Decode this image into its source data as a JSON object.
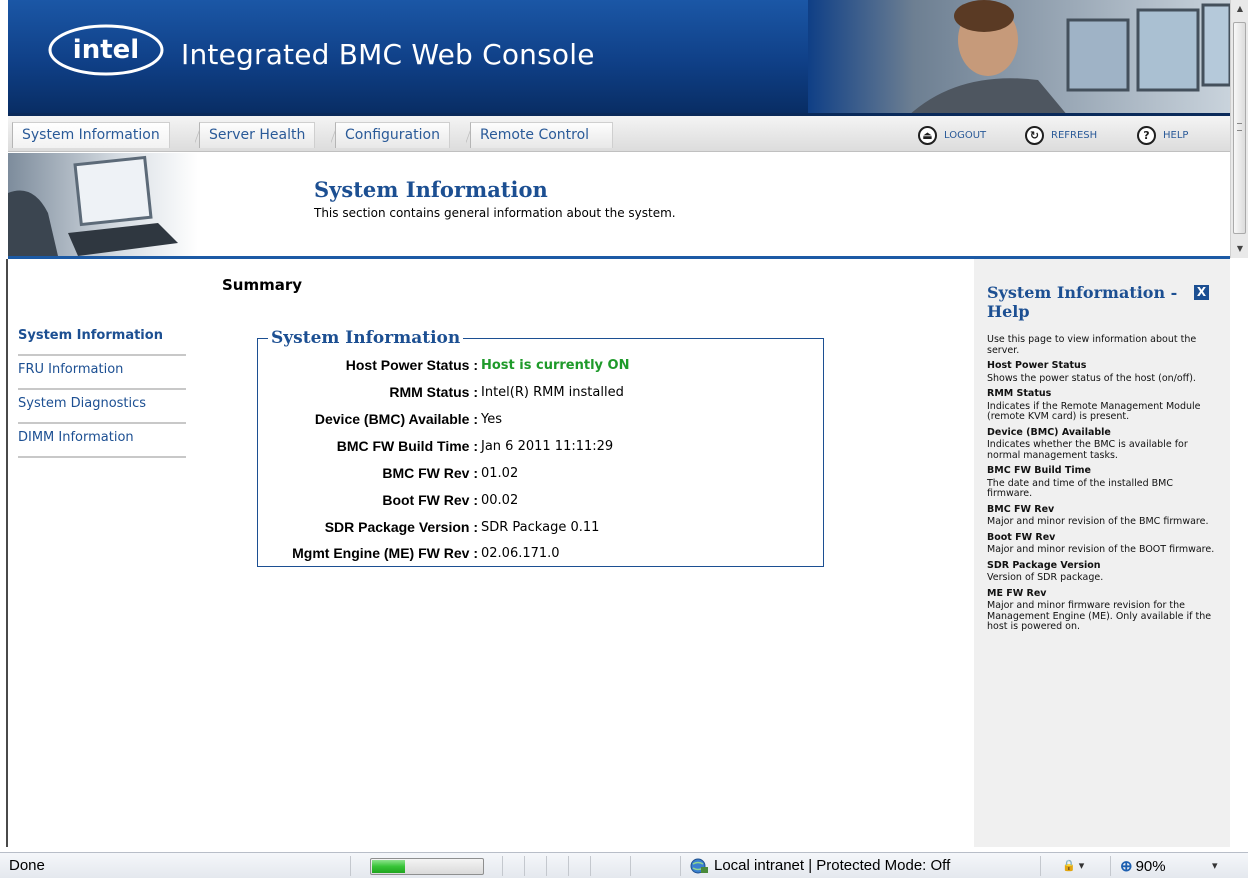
{
  "banner": {
    "brand": "intel",
    "title": "Integrated BMC Web Console"
  },
  "nav": {
    "tabs": [
      {
        "label": "System Information"
      },
      {
        "label": "Server Health"
      },
      {
        "label": "Configuration"
      },
      {
        "label": "Remote Control"
      }
    ],
    "actions": [
      {
        "label": "LOGOUT",
        "icon": "logout-icon"
      },
      {
        "label": "REFRESH",
        "icon": "refresh-icon"
      },
      {
        "label": "HELP",
        "icon": "help-icon"
      }
    ]
  },
  "header": {
    "title": "System Information",
    "description": "This section contains general information about the system."
  },
  "sidebar": {
    "items": [
      {
        "label": "System Information"
      },
      {
        "label": "FRU Information"
      },
      {
        "label": "System Diagnostics"
      },
      {
        "label": "DIMM Information"
      }
    ]
  },
  "summary": {
    "title": "Summary",
    "box_title": "System Information",
    "rows": [
      {
        "label": "Host Power Status :",
        "value": "Host is currently ON"
      },
      {
        "label": "RMM Status :",
        "value": "Intel(R) RMM installed"
      },
      {
        "label": "Device (BMC) Available :",
        "value": "Yes"
      },
      {
        "label": "BMC FW Build Time :",
        "value": "Jan 6 2011 11:11:29"
      },
      {
        "label": "BMC FW Rev :",
        "value": "01.02"
      },
      {
        "label": "Boot FW Rev :",
        "value": "00.02"
      },
      {
        "label": "SDR Package Version :",
        "value": "SDR Package 0.11"
      },
      {
        "label": "Mgmt Engine (ME) FW Rev :",
        "value": "02.06.171.0"
      }
    ]
  },
  "help": {
    "title": "System Information - Help",
    "close": "X",
    "intro": "Use this page to view information about the server.",
    "sections": [
      {
        "heading": "Host Power Status",
        "text": "Shows the power status of the host (on/off)."
      },
      {
        "heading": "RMM Status",
        "text": "Indicates if the Remote Management Module (remote KVM card) is present."
      },
      {
        "heading": "Device (BMC) Available",
        "text": "Indicates whether the BMC is available for normal management tasks."
      },
      {
        "heading": "BMC FW Build Time",
        "text": "The date and time of the installed BMC firmware."
      },
      {
        "heading": "BMC FW Rev",
        "text": "Major and minor revision of the BMC firmware."
      },
      {
        "heading": "Boot FW Rev",
        "text": "Major and minor revision of the BOOT firmware."
      },
      {
        "heading": "SDR Package Version",
        "text": "Version of SDR package."
      },
      {
        "heading": "ME FW Rev",
        "text": "Major and minor firmware revision for the Management Engine (ME). Only available if the host is powered on."
      }
    ]
  },
  "statusbar": {
    "status": "Done",
    "progress_fraction": 0.3,
    "zone": "Local intranet | Protected Mode: Off",
    "zoom": "90%"
  },
  "colors": {
    "brand_blue": "#1c4f92",
    "status_on": "#1e9a2a",
    "banner_blue": "#0f3f86"
  }
}
